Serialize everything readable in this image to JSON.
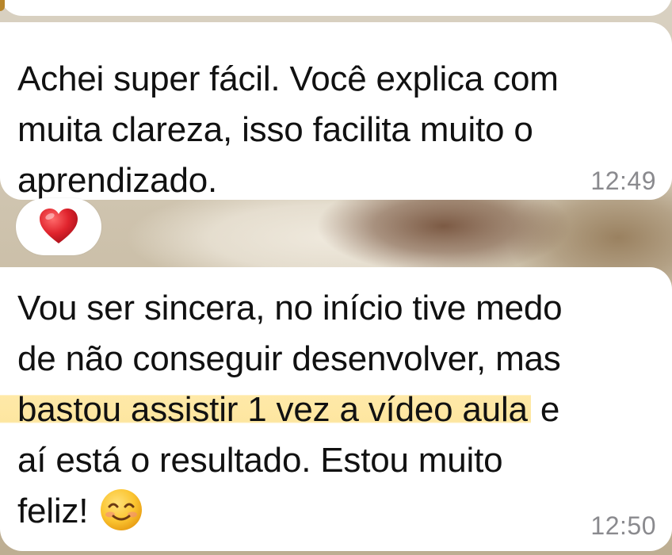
{
  "messages": [
    {
      "lines": [
        "Achei super fácil. Você explica com",
        "muita clareza, isso facilita muito o",
        "aprendizado."
      ],
      "time": "12:49",
      "reaction": "heart-emoji"
    },
    {
      "lines": [
        "Vou ser sincera, no início tive medo",
        "de não conseguir desenvolver, mas"
      ],
      "highlighted": "bastou assistir 1 vez a vídeo aula",
      "highlight_tail": " e",
      "lines_after": [
        "aí está o resultado. Estou muito",
        "feliz!"
      ],
      "trailing_emoji": "smiling-face-emoji",
      "time": "12:50"
    }
  ],
  "colors": {
    "bubble": "#ffffff",
    "text": "#111111",
    "timestamp": "#8a8a8e",
    "highlight": "#fde6a0",
    "heart": "#e0242d"
  }
}
